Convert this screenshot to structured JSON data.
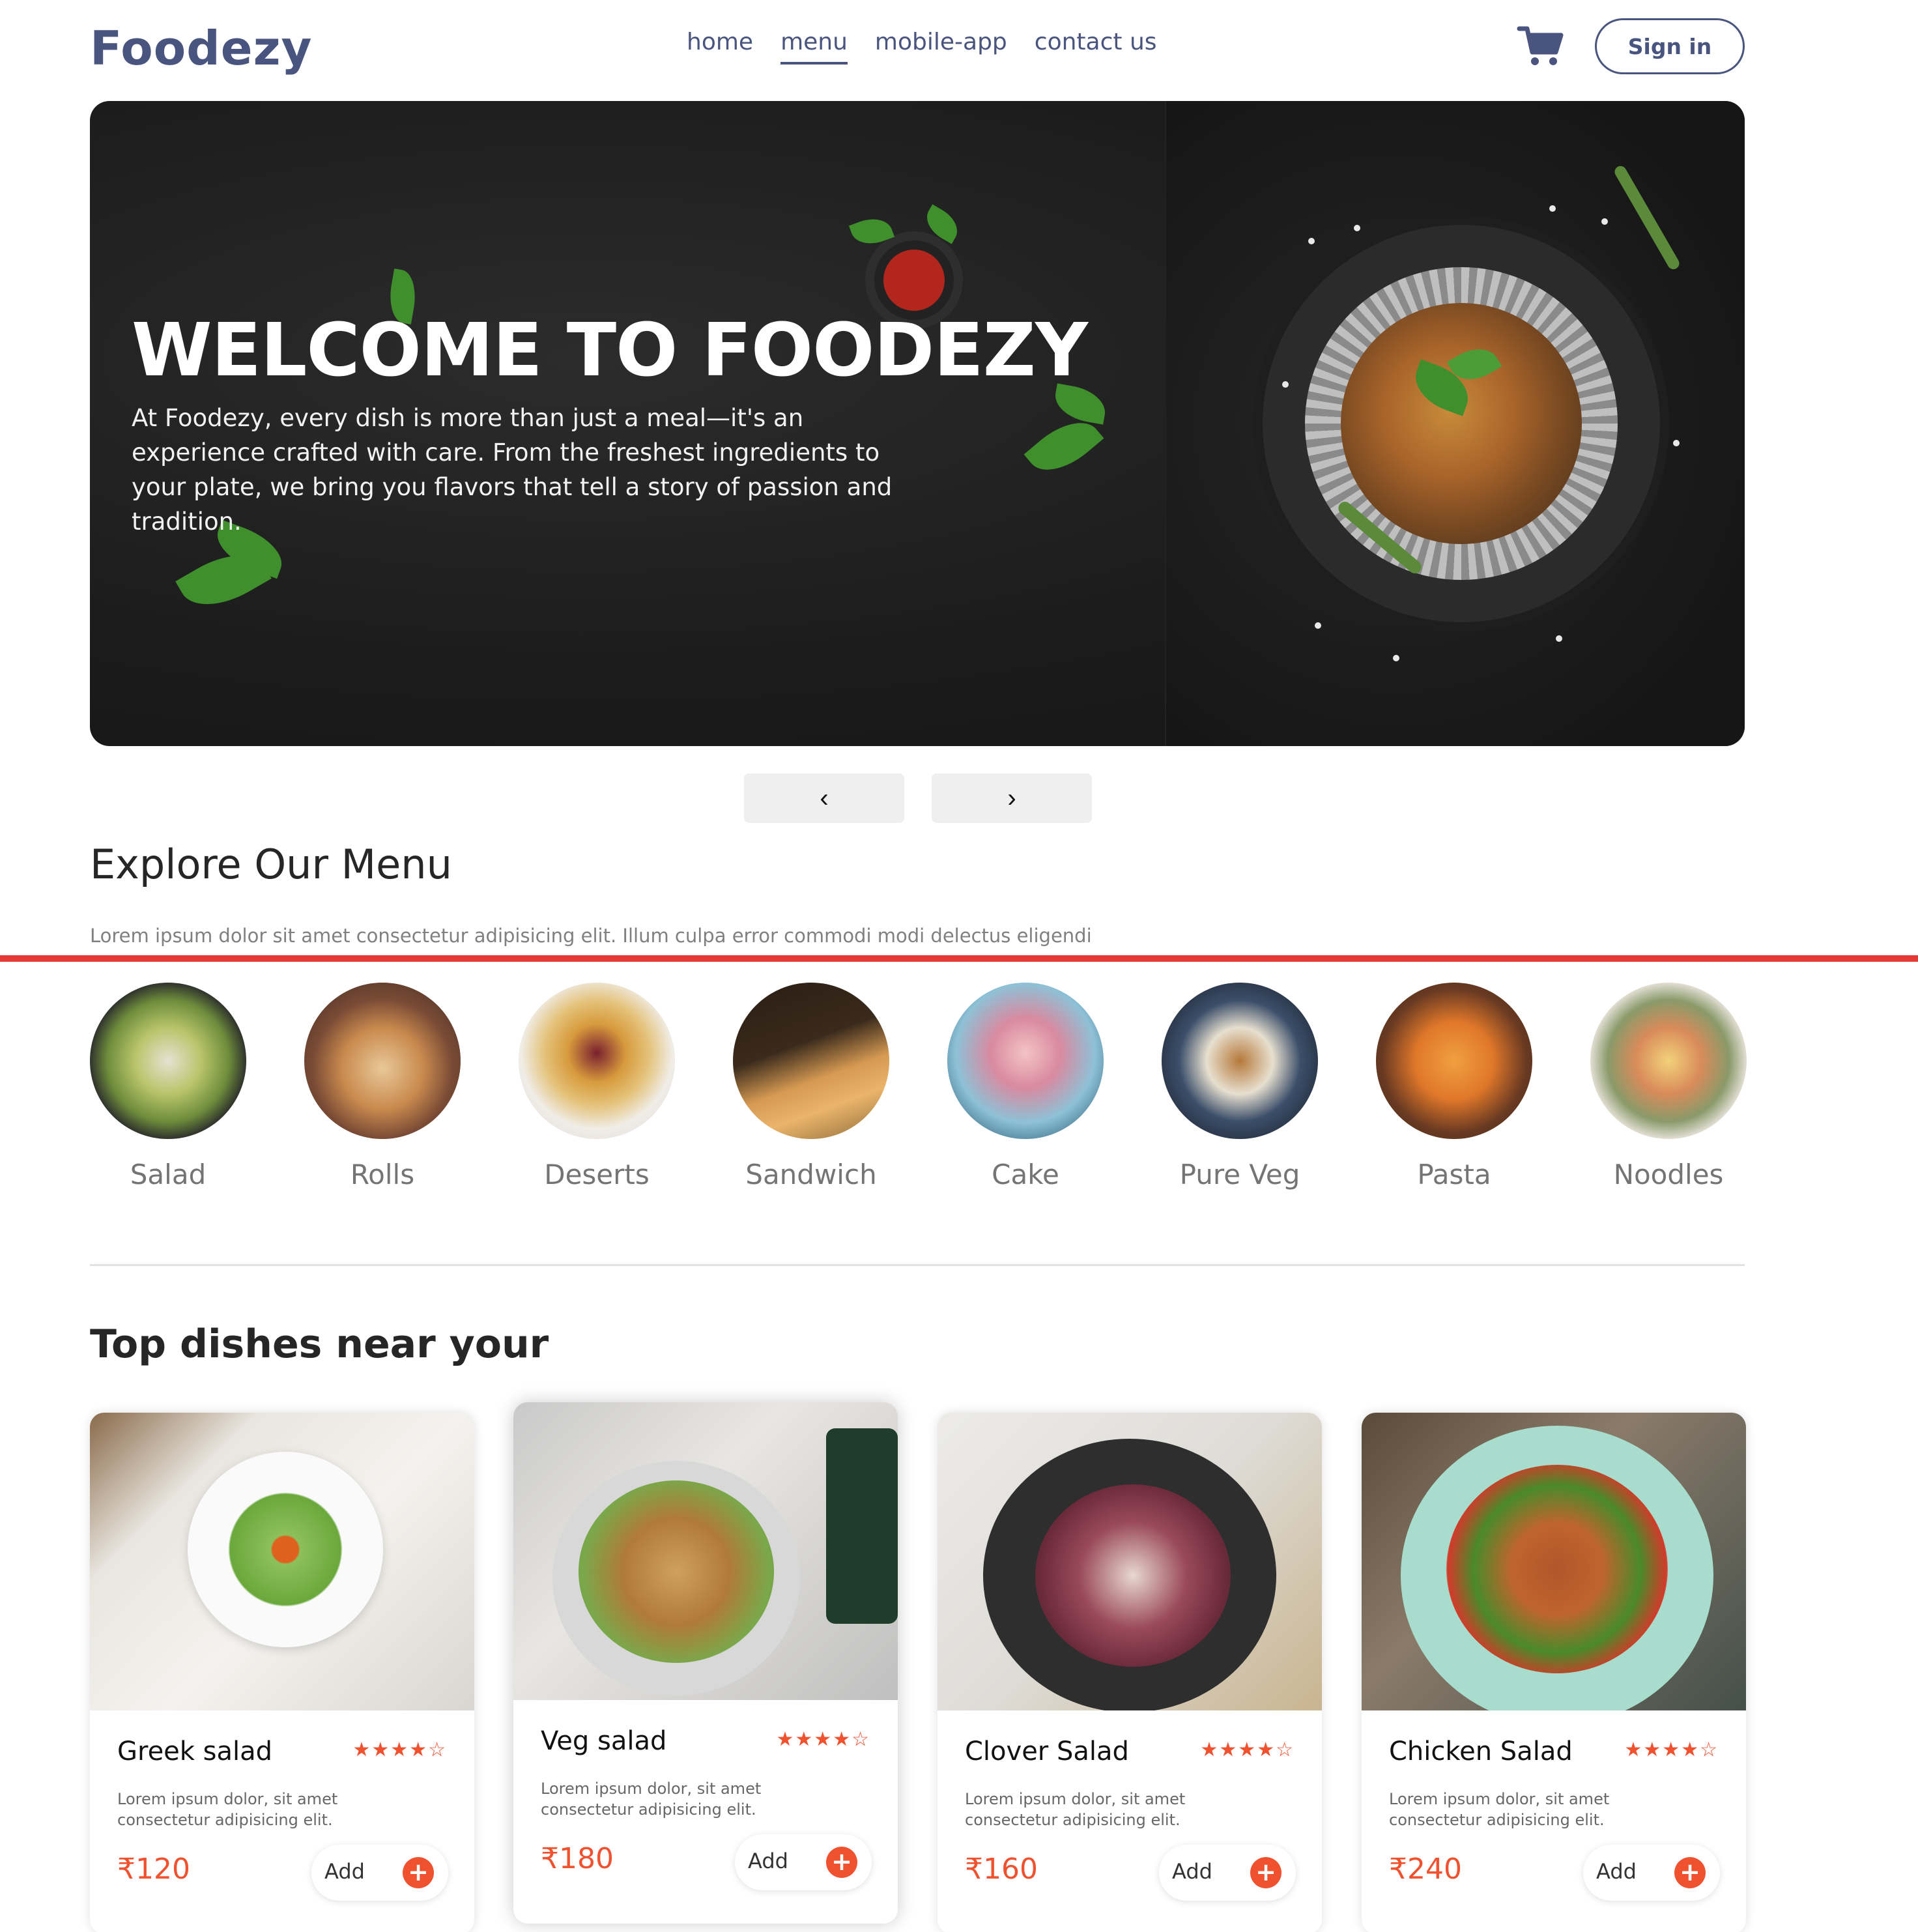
{
  "navbar": {
    "logo": "Foodezy",
    "links": [
      {
        "label": "home"
      },
      {
        "label": "menu"
      },
      {
        "label": "mobile-app"
      },
      {
        "label": "contact us"
      }
    ],
    "active_link": "menu",
    "cart_icon": "cart-icon",
    "signin_label": "Sign in"
  },
  "hero": {
    "title": "WELCOME TO FOODEZY",
    "text": "At Foodezy, every dish is more than just a meal—it's an experience crafted with care. From the freshest ingredients to your plate, we bring you flavors that tell a story of passion and tradition."
  },
  "carousel": {
    "prev_label": "‹",
    "next_label": "›"
  },
  "explore": {
    "title": "Explore Our Menu",
    "text": "Lorem ipsum dolor sit amet consectetur adipisicing elit. Illum culpa error commodi modi delectus eligendi"
  },
  "menu_items": [
    {
      "label": "Salad"
    },
    {
      "label": "Rolls"
    },
    {
      "label": "Deserts"
    },
    {
      "label": "Sandwich"
    },
    {
      "label": "Cake"
    },
    {
      "label": "Pure Veg"
    },
    {
      "label": "Pasta"
    },
    {
      "label": "Noodles"
    }
  ],
  "top_dishes": {
    "title": "Top dishes near your",
    "cards": [
      {
        "name": "Greek salad",
        "stars": "★★★★☆",
        "desc": "Lorem ipsum dolor, sit amet consectetur adipisicing elit.",
        "price": "₹120",
        "add_label": "Add",
        "plus": "+"
      },
      {
        "name": "Veg salad",
        "stars": "★★★★☆",
        "desc": "Lorem ipsum dolor, sit amet consectetur adipisicing elit.",
        "price": "₹180",
        "add_label": "Add",
        "plus": "+"
      },
      {
        "name": "Clover Salad",
        "stars": "★★★★☆",
        "desc": "Lorem ipsum dolor, sit amet consectetur adipisicing elit.",
        "price": "₹160",
        "add_label": "Add",
        "plus": "+"
      },
      {
        "name": "Chicken Salad",
        "stars": "★★★★☆",
        "desc": "Lorem ipsum dolor, sit amet consectetur adipisicing elit.",
        "price": "₹240",
        "add_label": "Add",
        "plus": "+"
      }
    ]
  },
  "colors": {
    "brand": "#49557e",
    "accent": "#f0512e",
    "divider_red": "#e53935"
  }
}
